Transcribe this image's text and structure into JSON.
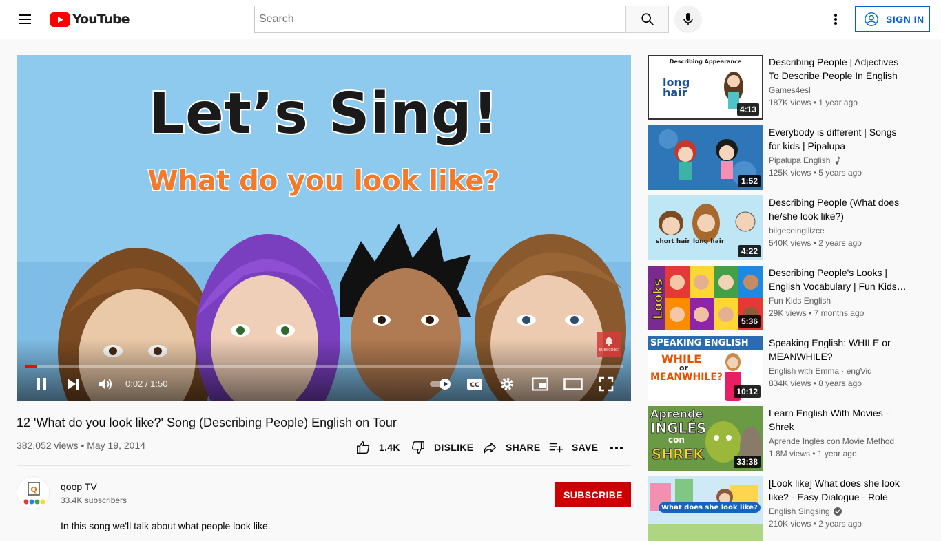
{
  "header": {
    "logo_text": "YouTube",
    "search_placeholder": "Search",
    "signin_label": "SIGN IN"
  },
  "player": {
    "art_title": "Let’s Sing!",
    "art_subtitle": "What do you look like?",
    "current_time": "0:02",
    "duration": "1:50",
    "progress_fraction": 0.02,
    "subscribe_watermark": "SUBSCRIBE"
  },
  "video": {
    "title": "12 'What do you look like?' Song (Describing People) English on Tour",
    "views": "382,052 views",
    "date": "May 19, 2014",
    "likes": "1.4K",
    "dislike_label": "DISLIKE",
    "share_label": "SHARE",
    "save_label": "SAVE"
  },
  "channel": {
    "name": "qoop TV",
    "subscribers": "33.4K subscribers",
    "subscribe_label": "SUBSCRIBE",
    "description": "In this song we'll talk about what people look like."
  },
  "recommendations": [
    {
      "title": "Describing People | Adjectives To Describe People In English",
      "channel": "Games4esl",
      "views": "187K views",
      "age": "1 year ago",
      "duration": "4:13",
      "thumb_text": "Describing Appearance",
      "thumb_text2": "long hair"
    },
    {
      "title": "Everybody is different | Songs for kids | Pipalupa",
      "channel": "Pipalupa English",
      "views": "125K views",
      "age": "5 years ago",
      "duration": "1:52",
      "badge": "music-note-icon"
    },
    {
      "title": "Describing People (What does he/she look like?)",
      "channel": "bilgeceingilizce",
      "views": "540K views",
      "age": "2 years ago",
      "duration": "4:22",
      "thumb_text": "short hair",
      "thumb_text2": "long hair"
    },
    {
      "title": "Describing People's Looks | English Vocabulary | Fun Kids…",
      "channel": "Fun Kids English",
      "views": "29K views",
      "age": "7 months ago",
      "duration": "5:36",
      "thumb_text": "Looks"
    },
    {
      "title": "Speaking English: WHILE or MEANWHILE?",
      "channel": "English with Emma · engVid",
      "views": "834K views",
      "age": "8 years ago",
      "duration": "10:12",
      "thumb_text": "SPEAKING ENGLISH",
      "thumb_text2": "WHILE",
      "thumb_text3": "or",
      "thumb_text4": "MEANWHILE?"
    },
    {
      "title": "Learn English With Movies - Shrek",
      "channel": "Aprende Inglés con Movie Method",
      "views": "1.8M views",
      "age": "1 year ago",
      "duration": "33:38",
      "thumb_text": "Aprende",
      "thumb_text2": "INGLÉS",
      "thumb_text3": "con",
      "thumb_text4": "SHREK"
    },
    {
      "title": "[Look like] What does she look like? - Easy Dialogue - Role Play",
      "channel": "English Singsing",
      "views": "210K views",
      "age": "2 years ago",
      "duration": "",
      "badge": "verified-icon",
      "thumb_text": "What does she look like?"
    }
  ]
}
